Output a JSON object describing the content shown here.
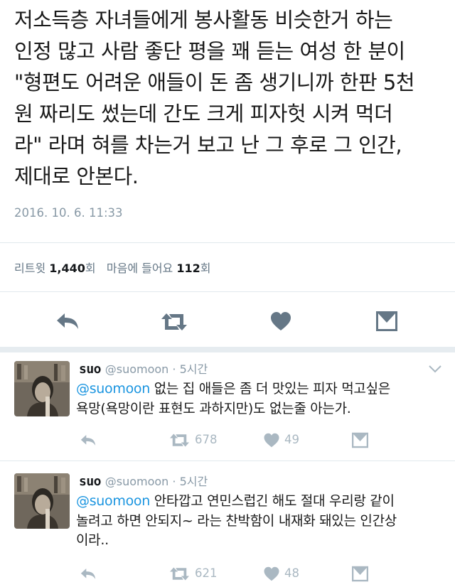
{
  "main_tweet": {
    "text_lines": [
      "저소득층 자녀들에게 봉사활동 비슷한거 하는",
      "인정 많고 사람 좋단 평을 꽤 듣는 여성 한 분이",
      "\"형편도 어려운 애들이 돈 좀 생기니까 한판 5천",
      "원 짜리도 썼는데 간도 크게 피자헛 시켜 먹더",
      "라\" 라며 혀를 차는거 보고 난 그 후로 그 인간,",
      "제대로 안본다."
    ],
    "timestamp": "2016. 10. 6. 11:33",
    "retweets_label": "리트윗",
    "retweets_count": "1,440",
    "retweets_suffix": "회",
    "likes_label": "마음에 들어요",
    "likes_count": "112",
    "likes_suffix": "회",
    "actions": {
      "reply_icon": "reply-icon",
      "retweet_icon": "retweet-icon",
      "like_icon": "heart-icon",
      "dm_icon": "envelope-icon"
    }
  },
  "replies": [
    {
      "name": "suo",
      "handle": "@suomoon · 5시간",
      "mention": "@suomoon",
      "text_first": " 없는 집 애들은 좀 더 맛있는 피자 먹고싶은",
      "text_rest": [
        "욕망(욕망이란 표현도 과하지만)도 없는줄 아는가."
      ],
      "retweets": "678",
      "likes": "49"
    },
    {
      "name": "suo",
      "handle": "@suomoon · 5시간",
      "mention": "@suomoon",
      "text_first": " 안타깝고 연민스럽긴 해도 절대 우리랑 같이",
      "text_rest": [
        "놀려고 하면 안되지~ 라는 찬박함이 내재화 돼있는 인간상",
        "이라.."
      ],
      "retweets": "621",
      "likes": "48"
    }
  ],
  "colors": {
    "icon_main": "#657786",
    "icon_reply": "#aab8c2",
    "mention": "#1b95e0",
    "separator": "#e1e8ed"
  }
}
